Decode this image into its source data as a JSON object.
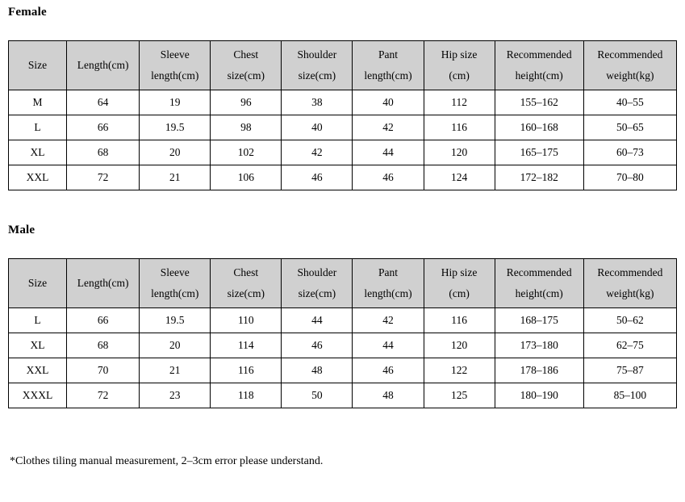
{
  "sections": [
    {
      "title": "Female",
      "columns": [
        {
          "line1": "Size",
          "line2": ""
        },
        {
          "line1": "Length(cm)",
          "line2": ""
        },
        {
          "line1": "Sleeve",
          "line2": "length(cm)"
        },
        {
          "line1": "Chest",
          "line2": "size(cm)"
        },
        {
          "line1": "Shoulder",
          "line2": "size(cm)"
        },
        {
          "line1": "Pant",
          "line2": "length(cm)"
        },
        {
          "line1": "Hip size",
          "line2": "(cm)"
        },
        {
          "line1": "Recommended",
          "line2": "height(cm)"
        },
        {
          "line1": "Recommended",
          "line2": "weight(kg)"
        }
      ],
      "rows": [
        [
          "M",
          "64",
          "19",
          "96",
          "38",
          "40",
          "112",
          "155–162",
          "40–55"
        ],
        [
          "L",
          "66",
          "19.5",
          "98",
          "40",
          "42",
          "116",
          "160–168",
          "50–65"
        ],
        [
          "XL",
          "68",
          "20",
          "102",
          "42",
          "44",
          "120",
          "165–175",
          "60–73"
        ],
        [
          "XXL",
          "72",
          "21",
          "106",
          "46",
          "46",
          "124",
          "172–182",
          "70–80"
        ]
      ]
    },
    {
      "title": "Male",
      "columns": [
        {
          "line1": "Size",
          "line2": ""
        },
        {
          "line1": "Length(cm)",
          "line2": ""
        },
        {
          "line1": "Sleeve",
          "line2": "length(cm)"
        },
        {
          "line1": "Chest",
          "line2": "size(cm)"
        },
        {
          "line1": "Shoulder",
          "line2": "size(cm)"
        },
        {
          "line1": "Pant",
          "line2": "length(cm)"
        },
        {
          "line1": "Hip size",
          "line2": "(cm)"
        },
        {
          "line1": "Recommended",
          "line2": "height(cm)"
        },
        {
          "line1": "Recommended",
          "line2": "weight(kg)"
        }
      ],
      "rows": [
        [
          "L",
          "66",
          "19.5",
          "110",
          "44",
          "42",
          "116",
          "168–175",
          "50–62"
        ],
        [
          "XL",
          "68",
          "20",
          "114",
          "46",
          "44",
          "120",
          "173–180",
          "62–75"
        ],
        [
          "XXL",
          "70",
          "21",
          "116",
          "48",
          "46",
          "122",
          "178–186",
          "75–87"
        ],
        [
          "XXXL",
          "72",
          "23",
          "118",
          "50",
          "48",
          "125",
          "180–190",
          "85–100"
        ]
      ]
    }
  ],
  "footnote": "*Clothes tiling manual measurement, 2–3cm error please understand.",
  "colors": {
    "header_background": "#d0d0d0",
    "cell_background": "#ffffff",
    "border": "#000000",
    "text": "#000000"
  }
}
